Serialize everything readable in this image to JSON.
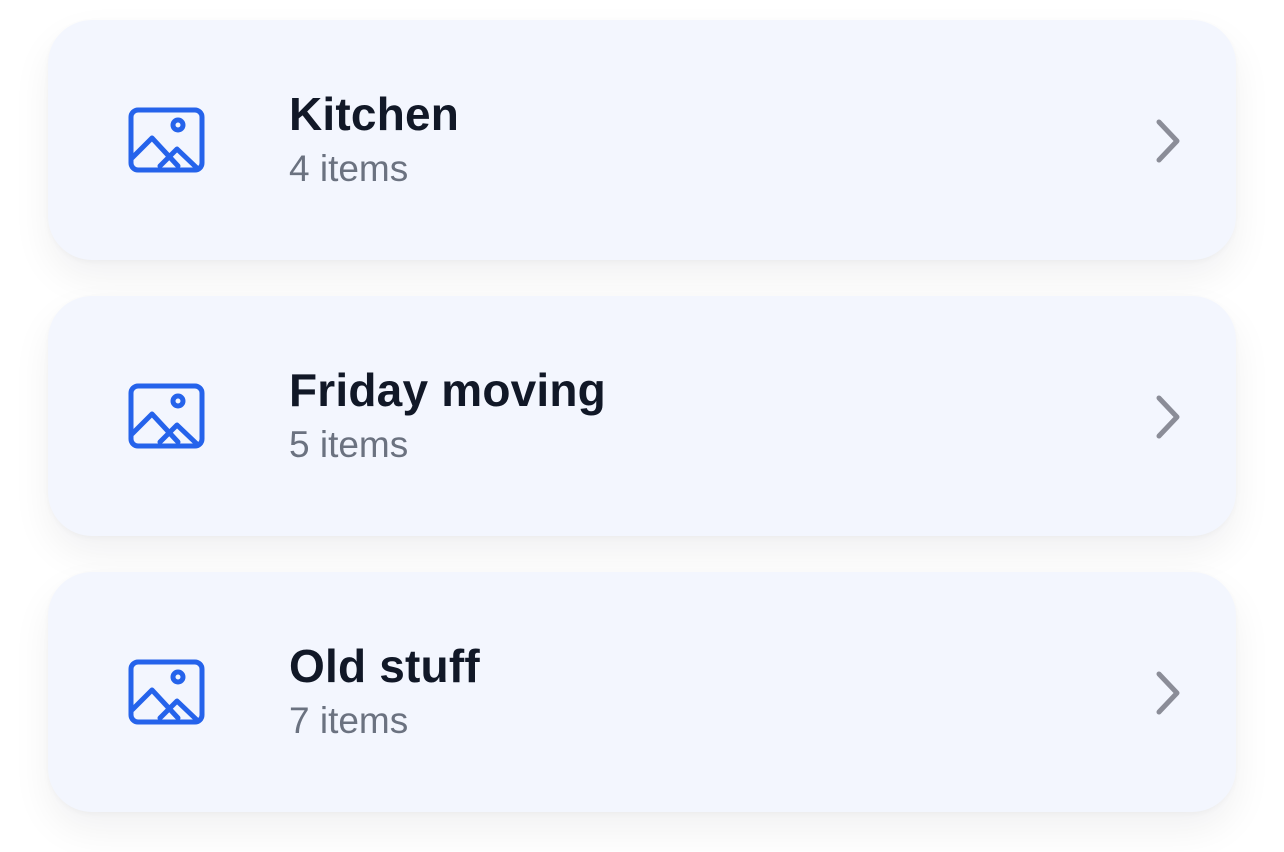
{
  "colors": {
    "card_background": "#f3f6fe",
    "icon_accent": "#2563eb",
    "title_text": "#111827",
    "count_text": "#6b7280",
    "chevron": "#8b8d98"
  },
  "lists": [
    {
      "title": "Kitchen",
      "count": "4 items",
      "icon": "image-icon",
      "trailing_icon": "chevron-right-icon"
    },
    {
      "title": "Friday moving",
      "count": "5 items",
      "icon": "image-icon",
      "trailing_icon": "chevron-right-icon"
    },
    {
      "title": "Old stuff",
      "count": "7 items",
      "icon": "image-icon",
      "trailing_icon": "chevron-right-icon"
    }
  ]
}
